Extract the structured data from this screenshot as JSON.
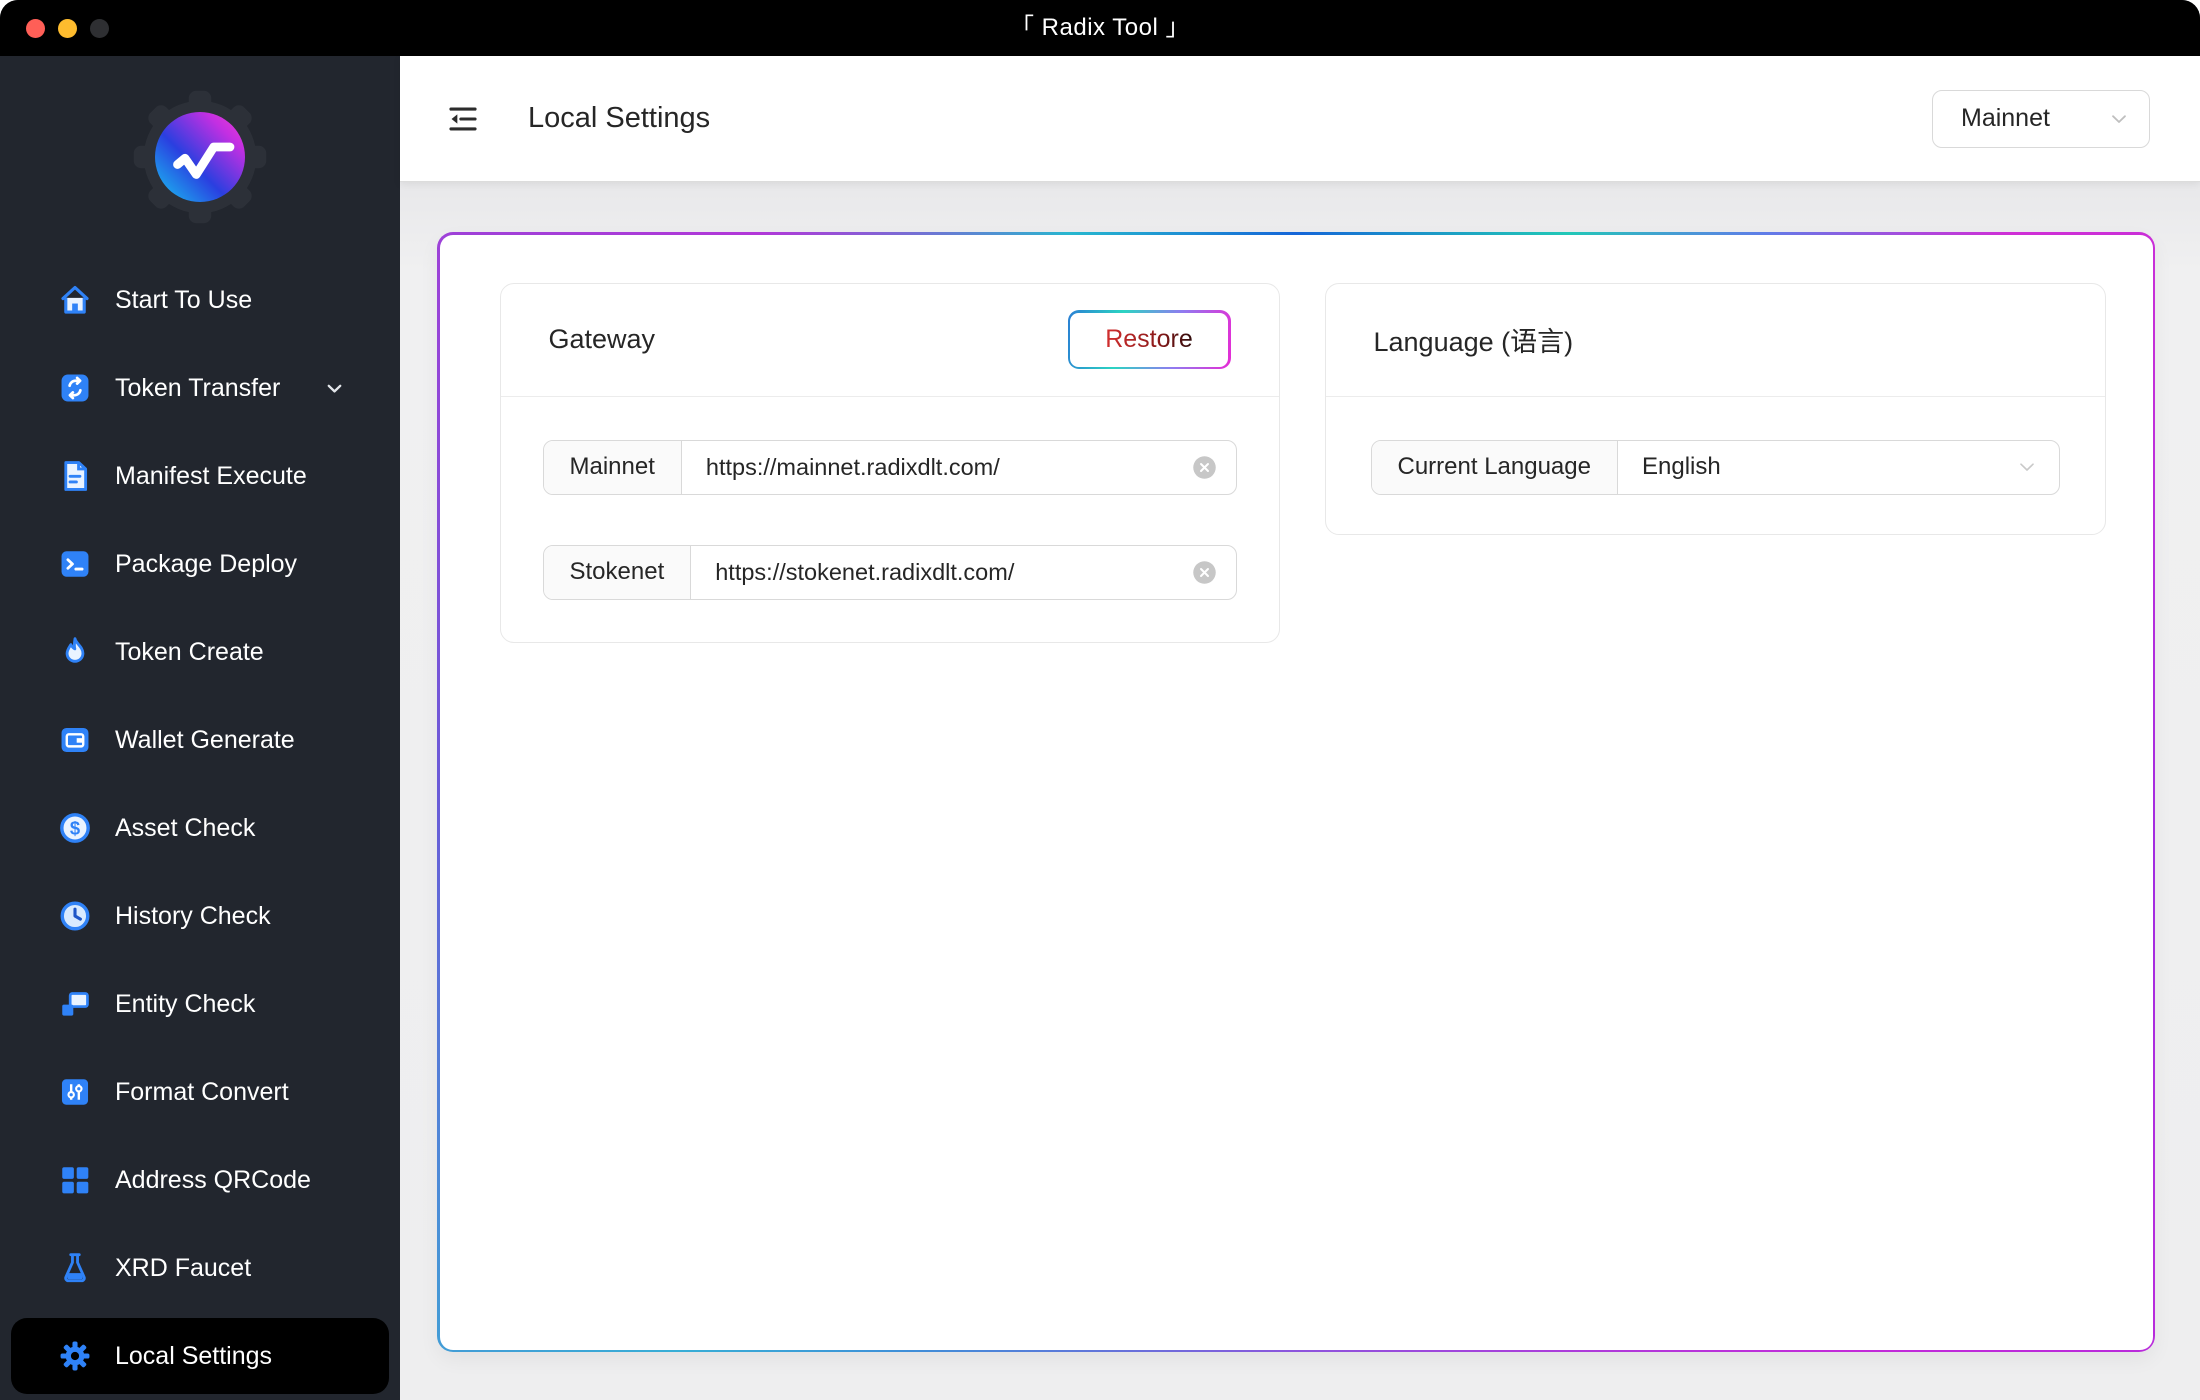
{
  "window": {
    "title": "「 Radix Tool 」"
  },
  "sidebar": {
    "items": [
      {
        "label": "Start To Use",
        "icon": "home-icon",
        "active": false
      },
      {
        "label": "Token Transfer",
        "icon": "transfer-icon",
        "active": false,
        "has_submenu": true
      },
      {
        "label": "Manifest Execute",
        "icon": "document-icon",
        "active": false
      },
      {
        "label": "Package Deploy",
        "icon": "terminal-icon",
        "active": false
      },
      {
        "label": "Token Create",
        "icon": "flame-icon",
        "active": false
      },
      {
        "label": "Wallet Generate",
        "icon": "wallet-icon",
        "active": false
      },
      {
        "label": "Asset Check",
        "icon": "dollar-circle-icon",
        "active": false
      },
      {
        "label": "History Check",
        "icon": "clock-icon",
        "active": false
      },
      {
        "label": "Entity Check",
        "icon": "blocks-icon",
        "active": false
      },
      {
        "label": "Format Convert",
        "icon": "sliders-icon",
        "active": false
      },
      {
        "label": "Address QRCode",
        "icon": "qrcode-icon",
        "active": false
      },
      {
        "label": "XRD Faucet",
        "icon": "flask-icon",
        "active": false
      },
      {
        "label": "Local Settings",
        "icon": "gear-icon",
        "active": true
      }
    ]
  },
  "header": {
    "title": "Local Settings",
    "network_select": {
      "value": "Mainnet"
    }
  },
  "settings": {
    "gateway": {
      "title": "Gateway",
      "restore_label": "Restore",
      "fields": [
        {
          "label": "Mainnet",
          "value": "https://mainnet.radixdlt.com/"
        },
        {
          "label": "Stokenet",
          "value": "https://stokenet.radixdlt.com/"
        }
      ]
    },
    "language": {
      "title": "Language (语言)",
      "field_label": "Current Language",
      "value": "English"
    }
  },
  "colors": {
    "accent_blue": "#2f82f7",
    "sidebar_bg": "#22262e",
    "active_item_bg": "#000000",
    "titlebar_bg": "#000000",
    "restore_text": "#c02c2c",
    "panel_border_gradient": [
      "#1565d8",
      "#22c8b7",
      "#cf2fd6",
      "#a22ce0",
      "#38aed6"
    ],
    "traffic_lights": [
      "#ff5f57",
      "#febc2e",
      "#2e2f32"
    ]
  }
}
